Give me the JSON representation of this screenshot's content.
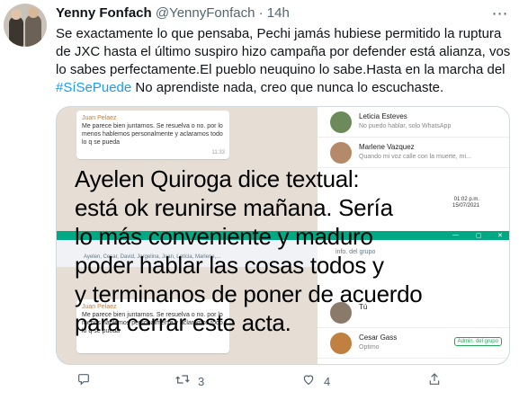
{
  "tweet": {
    "author_name": "Yenny Fonfach",
    "author_handle": "@YennyFonfach",
    "separator": "·",
    "time": "14h",
    "text_lines": [
      "Se exactamente lo que pensaba, Pechi jamás hubiese permitido la ruptura",
      "de JXC hasta el último suspiro hizo campaña por defender está alianza, vos",
      "lo sabes perfectamente.El pueblo neuquino lo sabe.Hasta en la marcha del"
    ],
    "hashtag": "#SíSePuede",
    "text_tail": " No aprendiste nada, creo que nunca lo escuchaste.",
    "more_icon": "ellipsis-icon"
  },
  "media": {
    "overlay_lines": [
      "Ayelen Quiroga dice textual:",
      "está ok reunirse mañana. Sería",
      "lo más conveniente y maduro",
      "poder hablar las cosas todos y",
      "y terminanos de poner de acuerdo",
      "para cerrar este acta."
    ],
    "bubble_top": {
      "sender": "Juan Pelaez",
      "text": "Me parece bien juntarnos. Se resuelva o no. por lo menos hablemos personalmente y aclaramos todo lo q se pueda",
      "time": "11:33"
    },
    "bubble_bottom": {
      "sender": "Juan Pelaez",
      "text": "Me parece bien juntarnos. Se resuelva o no. por lo menos hablemos personalmente y aclaramos todo lo q se pueda"
    },
    "contacts_top": [
      {
        "name": "Leticia Esteves",
        "status": "No puedo hablar, solo WhatsApp"
      },
      {
        "name": "Marlene Vazquez",
        "status": "Quando mi voz calle con la muerte, mi..."
      }
    ],
    "contacts_bottom": [
      {
        "name": "Tú",
        "status": ""
      },
      {
        "name": "Cesar Gass",
        "status": "Optimo",
        "badge": "Admin. del grupo"
      }
    ],
    "clock_time": "01:02 p.m.",
    "clock_date": "15/07/2021",
    "members": "Ayelen, Cesar, David, Jorgelina, Juan, Leticia, Marlene,...",
    "search_label": "info. del grupo"
  },
  "actions": {
    "reply_icon": "reply-icon",
    "retweet_icon": "retweet-icon",
    "retweet_count": "3",
    "like_icon": "heart-icon",
    "like_count": "4",
    "share_icon": "share-icon"
  }
}
